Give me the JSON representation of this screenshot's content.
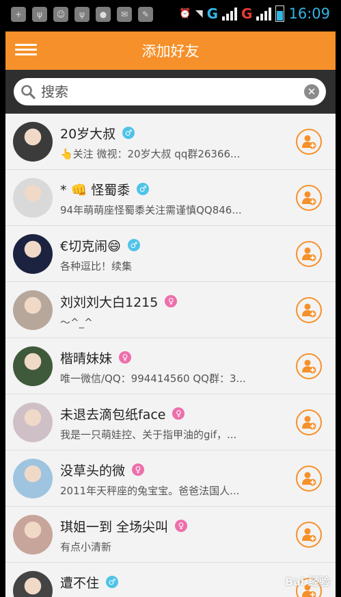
{
  "status_bar": {
    "time": "16:09",
    "network_letter_1": "G",
    "network_letter_2": "G"
  },
  "header": {
    "title": "添加好友"
  },
  "search": {
    "placeholder": "搜索"
  },
  "colors": {
    "accent": "#f6902a",
    "male": "#4fc3e8",
    "female": "#ec6fab"
  },
  "friends": [
    {
      "name": "20岁大叔",
      "gender": "male",
      "desc": "👆关注 微视：20岁大叔 qq群26366...",
      "avatar_bg": "#3b3b3b"
    },
    {
      "name": "*  👊 怪蜀黍",
      "gender": "male",
      "desc": "94年萌萌座怪蜀黍关注需谨慎QQ846...",
      "avatar_bg": "#d9d9d9"
    },
    {
      "name": "€切克闹😄",
      "gender": "male",
      "desc": "各种逗比！续集",
      "avatar_bg": "#1c2340"
    },
    {
      "name": "刘刘刘大白1215",
      "gender": "female",
      "desc": "～^_^",
      "avatar_bg": "#b7a79b"
    },
    {
      "name": "楷晴妹妹",
      "gender": "female",
      "desc": "唯一微信/QQ：994414560 QQ群：3...",
      "avatar_bg": "#3f5a3a"
    },
    {
      "name": "未退去滴包纸face",
      "gender": "female",
      "desc": "我是一只萌娃控、关于指甲油的gif，...",
      "avatar_bg": "#cfc0c8"
    },
    {
      "name": "没草头的微",
      "gender": "female",
      "desc": "2011年天秤座的兔宝宝。爸爸法国人...",
      "avatar_bg": "#9ec4e0"
    },
    {
      "name": "琪姐一到 全场尖叫",
      "gender": "female",
      "desc": "有点小清新",
      "avatar_bg": "#c7a59a"
    },
    {
      "name": "遭不住",
      "gender": "male",
      "desc": "",
      "avatar_bg": "#444444"
    }
  ],
  "gender_symbols": {
    "male": "♂",
    "female": "♀"
  }
}
